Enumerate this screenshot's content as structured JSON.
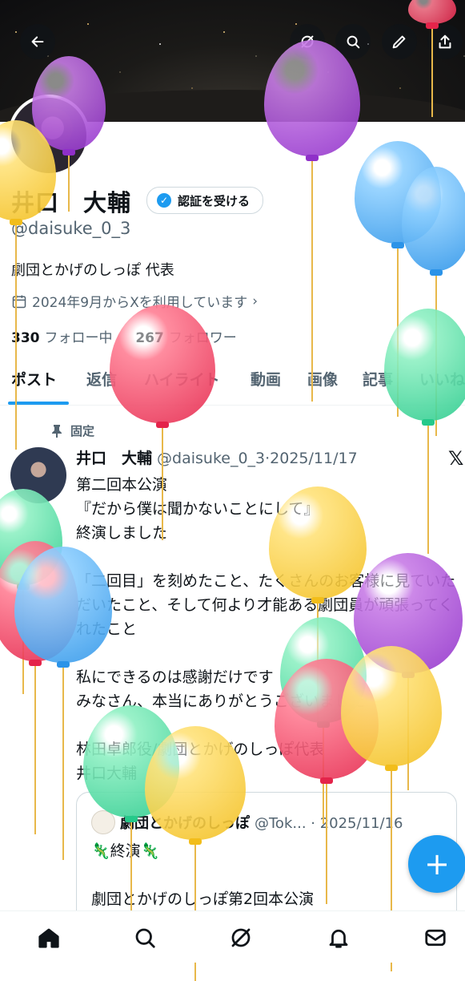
{
  "header": {
    "back_icon": "arrow-left-icon",
    "icons": [
      "grok-icon",
      "search-icon",
      "edit-icon",
      "share-icon"
    ]
  },
  "profile": {
    "name": "井口　大輔",
    "verify_button": "認証を受ける",
    "handle": "@daisuke_0_3",
    "bio": "劇団とかげのしっぽ 代表",
    "joined": "2024年9月からXを利用しています",
    "following_count": "330",
    "following_label": "フォロー中",
    "followers_count": "267",
    "followers_label": "フォロワー"
  },
  "tabs": [
    "ポスト",
    "返信",
    "ハイライト",
    "動画",
    "画像",
    "記事",
    "いいね"
  ],
  "post": {
    "pinned_label": "固定",
    "author_name": "井口　大輔",
    "author_meta": "@daisuke_0_3·2025/11/17",
    "body": "第二回本公演\n『だから僕は聞かないことにして』\n終演しました\n\n「二回目」を刻めたこと、たくさんのお客様に見ていただいたこと、そして何より才能ある劇団員が頑張ってくれたこと\n\n私にできるのは感謝だけです\nみなさん、本当にありがとうございました\n\n林田卓郎役/劇団とかげのしっぽ代表\n井口大輔",
    "quote": {
      "name": "劇団とかげのしっぽ",
      "meta": "@Tok... · 2025/11/16",
      "body": "🦎終演🦎\n\n劇団とかげのしっぽ第2回本公演"
    }
  },
  "fab": "+",
  "colors": {
    "accent": "#1d9bf0",
    "text": "#0f1419",
    "muted": "#536471"
  },
  "nav": [
    "home-icon",
    "search-icon",
    "grok-icon",
    "notifications-icon",
    "messages-icon"
  ],
  "balloon_colors": [
    "purple",
    "yellow",
    "blue",
    "red",
    "green"
  ]
}
